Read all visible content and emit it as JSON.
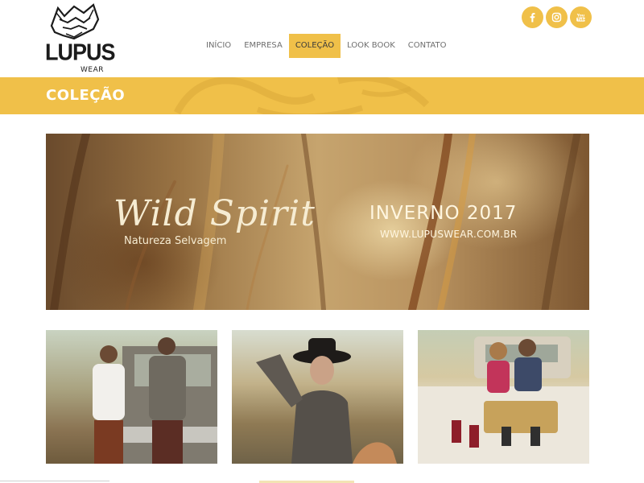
{
  "brand": {
    "name": "LUPUS",
    "sub": "WEAR",
    "color": "#f0c049"
  },
  "nav": {
    "items": [
      {
        "label": "INÍCIO"
      },
      {
        "label": "EMPRESA"
      },
      {
        "label": "COLEÇÃO"
      },
      {
        "label": "LOOK BOOK"
      },
      {
        "label": "CONTATO"
      }
    ],
    "active": "COLEÇÃO"
  },
  "social": [
    "facebook-icon",
    "instagram-icon",
    "youtube-icon"
  ],
  "page": {
    "title": "COLEÇÃO"
  },
  "hero": {
    "script_title": "Wild Spirit",
    "tagline": "Natureza Selvagem",
    "season": "INVERNO 2017",
    "url": "WWW.LUPUSWEAR.COM.BR"
  },
  "gallery": [
    "men-denim-truck-photo",
    "woman-hat-horse-photo",
    "kids-truck-photo"
  ]
}
